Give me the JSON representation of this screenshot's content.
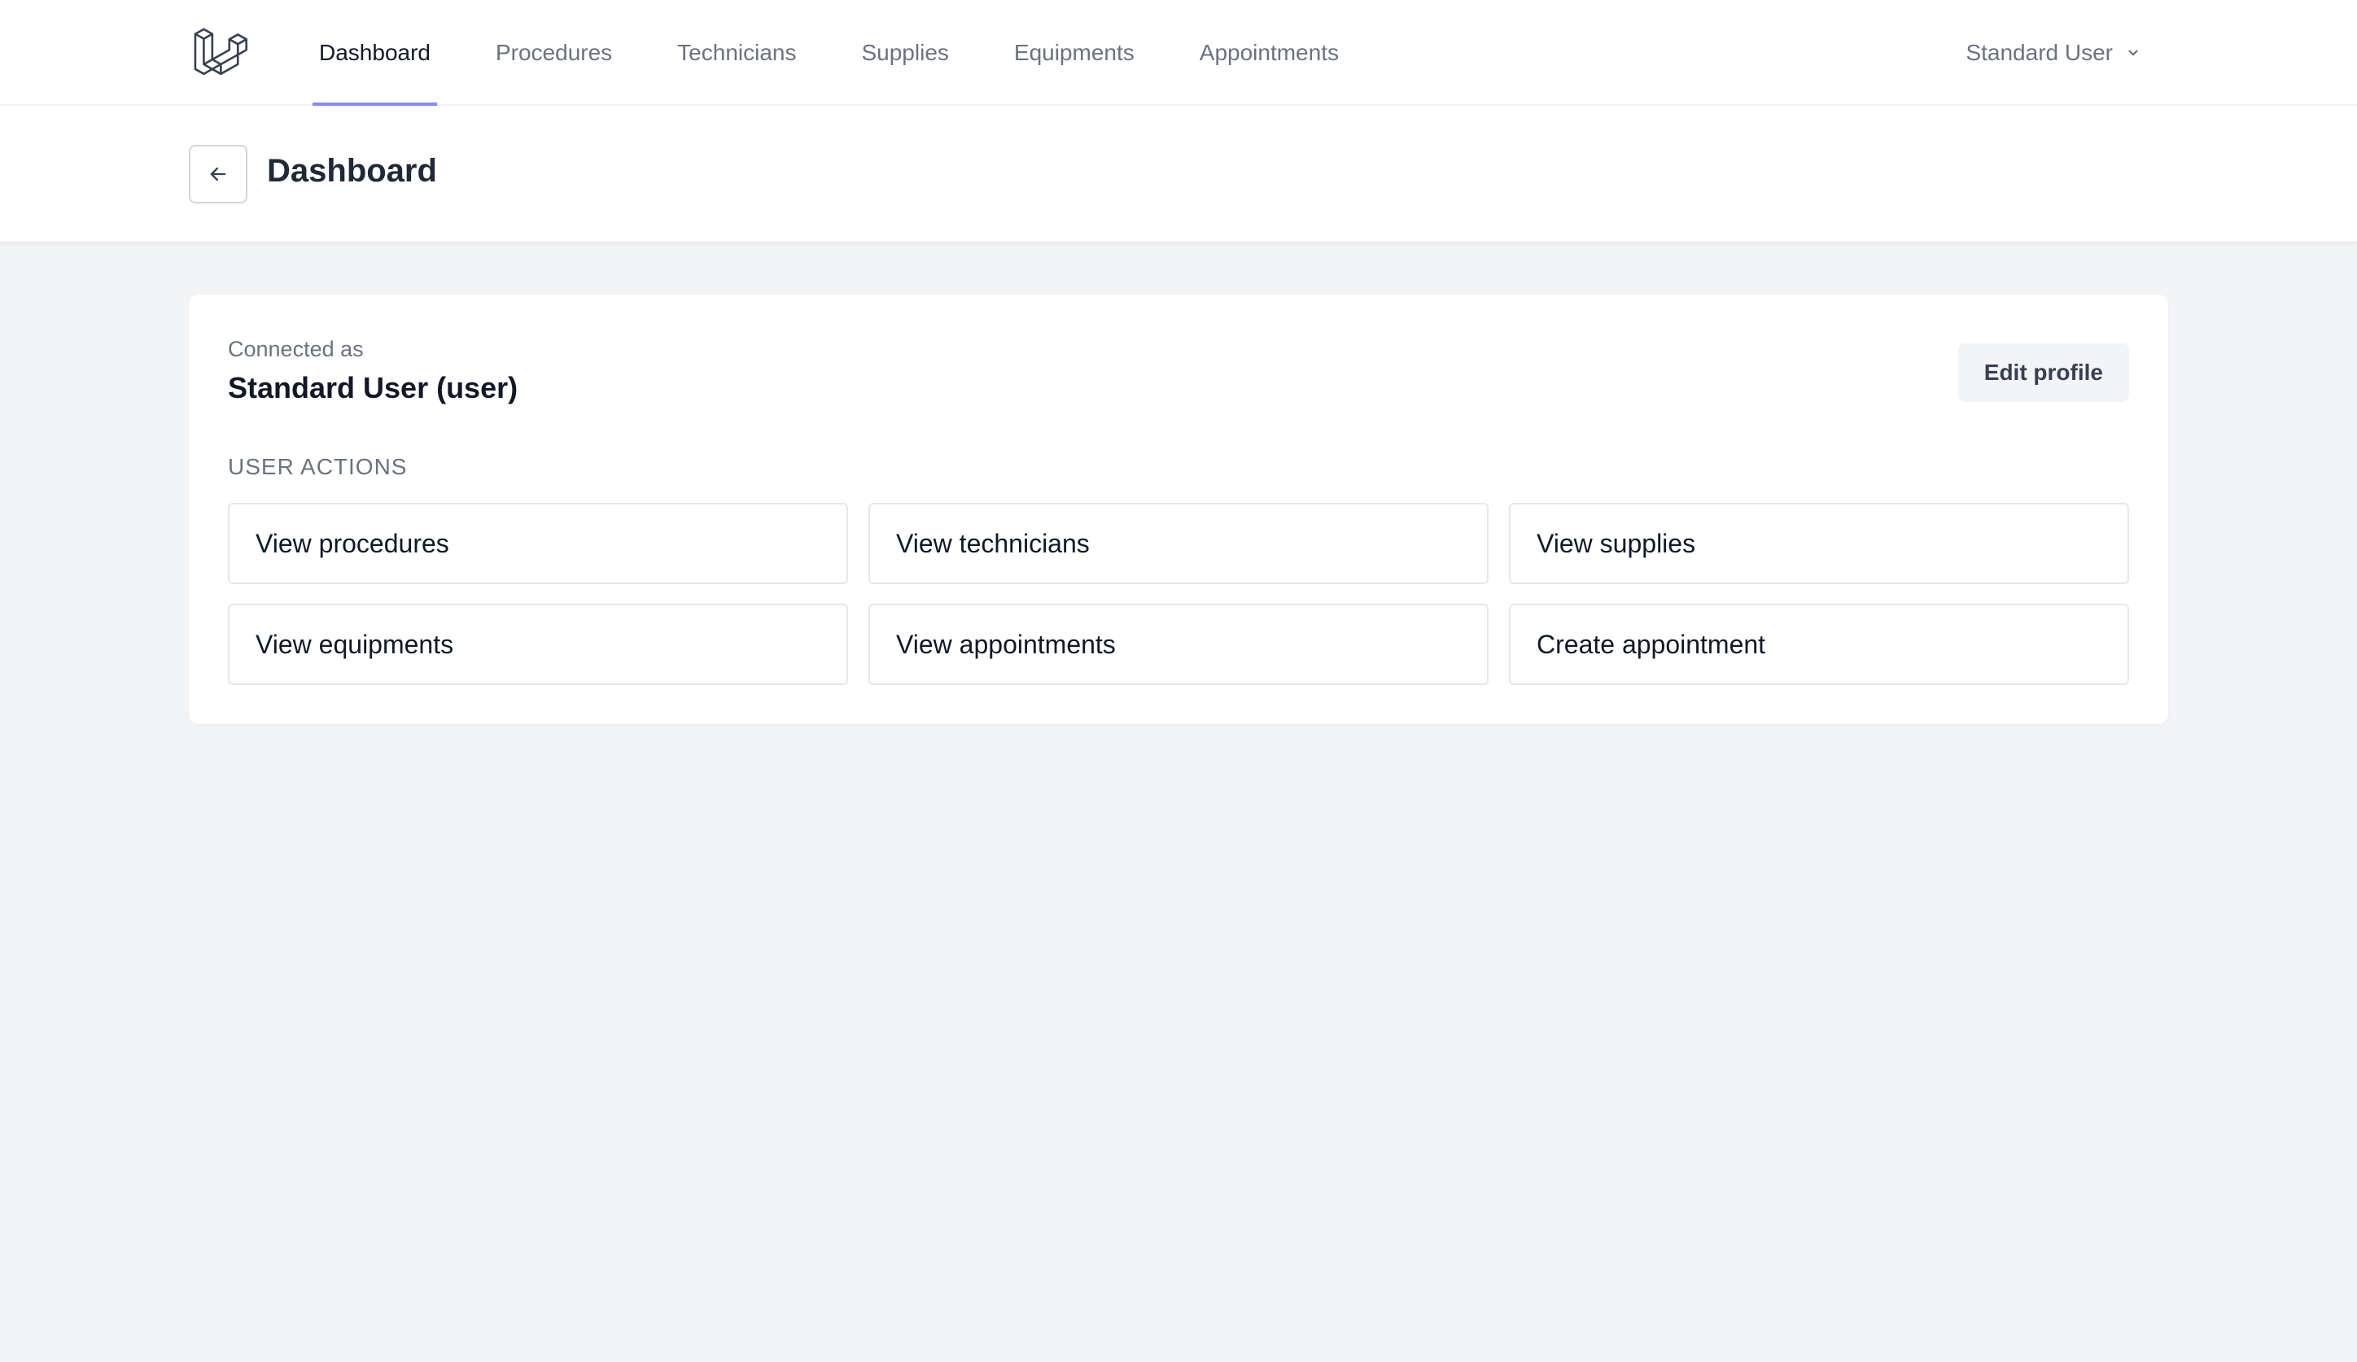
{
  "nav": {
    "logo": "laravel-logo",
    "items": [
      {
        "label": "Dashboard",
        "active": true
      },
      {
        "label": "Procedures",
        "active": false
      },
      {
        "label": "Technicians",
        "active": false
      },
      {
        "label": "Supplies",
        "active": false
      },
      {
        "label": "Equipments",
        "active": false
      },
      {
        "label": "Appointments",
        "active": false
      }
    ],
    "user_menu_label": "Standard User",
    "user_menu_icon": "chevron-down-icon"
  },
  "header": {
    "back_icon": "arrow-left-icon",
    "title": "Dashboard"
  },
  "card": {
    "connected_label": "Connected as",
    "connected_user": "Standard User (user)",
    "edit_profile_label": "Edit profile",
    "section_title": "USER ACTIONS",
    "actions": [
      {
        "label": "View procedures"
      },
      {
        "label": "View technicians"
      },
      {
        "label": "View supplies"
      },
      {
        "label": "View equipments"
      },
      {
        "label": "View appointments"
      },
      {
        "label": "Create appointment"
      }
    ]
  },
  "colors": {
    "accent": "#818cf8",
    "page_background": "#f3f4f6",
    "surface": "#ffffff"
  }
}
